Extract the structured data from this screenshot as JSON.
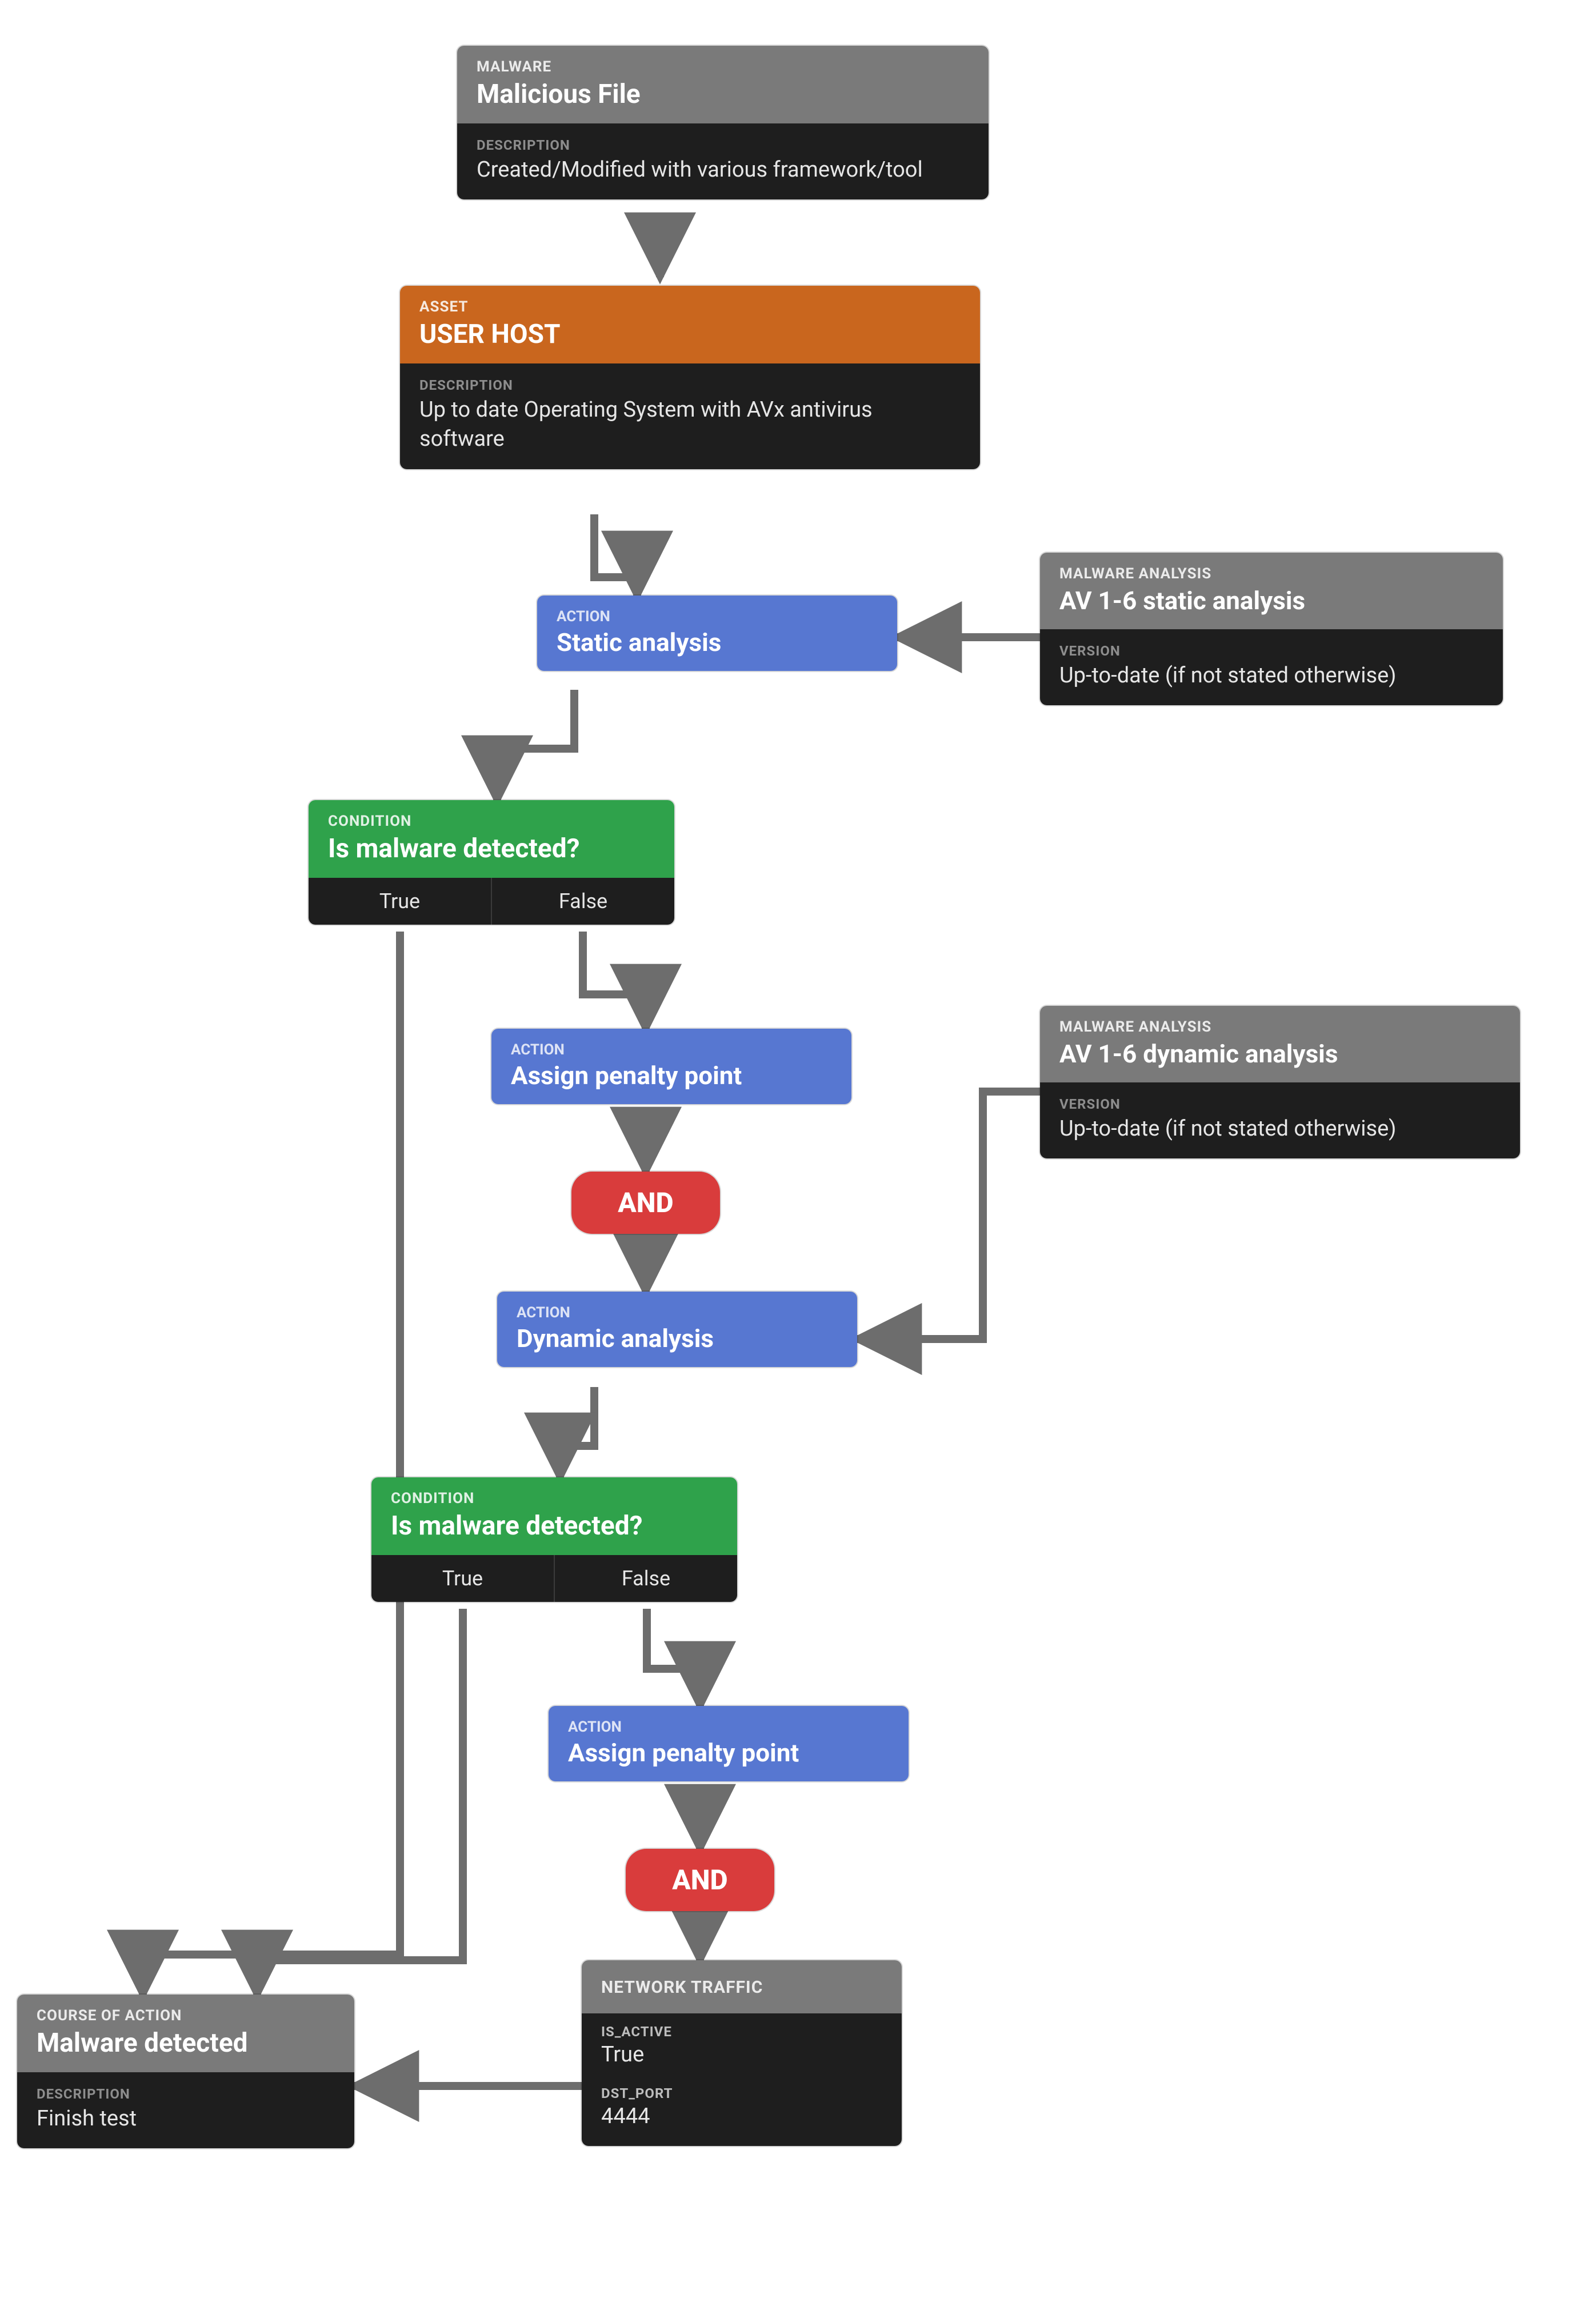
{
  "chart_data": {
    "type": "flowchart",
    "nodes": [
      {
        "id": "malware",
        "kind": "entity",
        "header": "MALWARE",
        "title": "Malicious File",
        "fields": [
          {
            "label": "DESCRIPTION",
            "value": "Created/Modified with various framework/tool"
          }
        ]
      },
      {
        "id": "asset",
        "kind": "entity",
        "header": "ASSET",
        "title": "USER HOST",
        "fields": [
          {
            "label": "DESCRIPTION",
            "value": "Up to date Operating System with AVx antivirus software"
          }
        ]
      },
      {
        "id": "static_side",
        "kind": "entity",
        "header": "MALWARE ANALYSIS",
        "title": "AV 1-6 static analysis",
        "fields": [
          {
            "label": "VERSION",
            "value": "Up-to-date (if not stated otherwise)"
          }
        ]
      },
      {
        "id": "dynamic_side",
        "kind": "entity",
        "header": "MALWARE ANALYSIS",
        "title": "AV 1-6 dynamic analysis",
        "fields": [
          {
            "label": "VERSION",
            "value": "Up-to-date (if not stated otherwise)"
          }
        ]
      },
      {
        "id": "act_static",
        "kind": "action",
        "header": "ACTION",
        "title": "Static analysis"
      },
      {
        "id": "cond1",
        "kind": "condition",
        "header": "CONDITION",
        "title": "Is malware detected?",
        "options": [
          "True",
          "False"
        ]
      },
      {
        "id": "act_penalty1",
        "kind": "action",
        "header": "ACTION",
        "title": "Assign penalty point"
      },
      {
        "id": "and1",
        "kind": "operator",
        "title": "AND"
      },
      {
        "id": "act_dynamic",
        "kind": "action",
        "header": "ACTION",
        "title": "Dynamic analysis"
      },
      {
        "id": "cond2",
        "kind": "condition",
        "header": "CONDITION",
        "title": "Is malware detected?",
        "options": [
          "True",
          "False"
        ]
      },
      {
        "id": "act_penalty2",
        "kind": "action",
        "header": "ACTION",
        "title": "Assign penalty point"
      },
      {
        "id": "and2",
        "kind": "operator",
        "title": "AND"
      },
      {
        "id": "net",
        "kind": "entity",
        "header": "NETWORK TRAFFIC",
        "fields": [
          {
            "label": "IS_ACTIVE",
            "value": "True"
          },
          {
            "label": "DST_PORT",
            "value": "4444"
          }
        ]
      },
      {
        "id": "coa",
        "kind": "entity",
        "header": "COURSE OF ACTION",
        "title": "Malware detected",
        "fields": [
          {
            "label": "DESCRIPTION",
            "value": "Finish test"
          }
        ]
      }
    ],
    "edges": [
      {
        "from": "malware",
        "to": "asset"
      },
      {
        "from": "asset",
        "to": "act_static"
      },
      {
        "from": "static_side",
        "to": "act_static"
      },
      {
        "from": "act_static",
        "to": "cond1"
      },
      {
        "from": "cond1",
        "branch": "True",
        "to": "coa"
      },
      {
        "from": "cond1",
        "branch": "False",
        "to": "act_penalty1"
      },
      {
        "from": "act_penalty1",
        "to": "and1"
      },
      {
        "from": "and1",
        "to": "act_dynamic"
      },
      {
        "from": "dynamic_side",
        "to": "act_dynamic"
      },
      {
        "from": "act_dynamic",
        "to": "cond2"
      },
      {
        "from": "cond2",
        "branch": "True",
        "to": "coa"
      },
      {
        "from": "cond2",
        "branch": "False",
        "to": "act_penalty2"
      },
      {
        "from": "act_penalty2",
        "to": "and2"
      },
      {
        "from": "and2",
        "to": "net"
      },
      {
        "from": "net",
        "to": "coa"
      }
    ]
  },
  "malware": {
    "header": "MALWARE",
    "title": "Malicious File",
    "desc_label": "DESCRIPTION",
    "desc": "Created/Modified with various framework/tool"
  },
  "asset": {
    "header": "ASSET",
    "title": "USER HOST",
    "desc_label": "DESCRIPTION",
    "desc": "Up to date Operating System with AVx antivirus software"
  },
  "static_side": {
    "header": "MALWARE ANALYSIS",
    "title": "AV 1-6 static analysis",
    "ver_label": "VERSION",
    "ver": "Up-to-date (if not stated otherwise)"
  },
  "dynamic_side": {
    "header": "MALWARE ANALYSIS",
    "title": "AV 1-6 dynamic analysis",
    "ver_label": "VERSION",
    "ver": "Up-to-date (if not stated otherwise)"
  },
  "act_static": {
    "header": "ACTION",
    "title": "Static analysis"
  },
  "act_penalty1": {
    "header": "ACTION",
    "title": "Assign penalty point"
  },
  "act_dynamic": {
    "header": "ACTION",
    "title": "Dynamic analysis"
  },
  "act_penalty2": {
    "header": "ACTION",
    "title": "Assign penalty point"
  },
  "cond1": {
    "header": "CONDITION",
    "title": "Is malware detected?",
    "t": "True",
    "f": "False"
  },
  "cond2": {
    "header": "CONDITION",
    "title": "Is malware detected?",
    "t": "True",
    "f": "False"
  },
  "and1": {
    "label": "AND"
  },
  "and2": {
    "label": "AND"
  },
  "net": {
    "header": "NETWORK TRAFFIC",
    "f1l": "IS_ACTIVE",
    "f1v": "True",
    "f2l": "DST_PORT",
    "f2v": "4444"
  },
  "coa": {
    "header": "COURSE OF ACTION",
    "title": "Malware detected",
    "desc_label": "DESCRIPTION",
    "desc": "Finish test"
  }
}
